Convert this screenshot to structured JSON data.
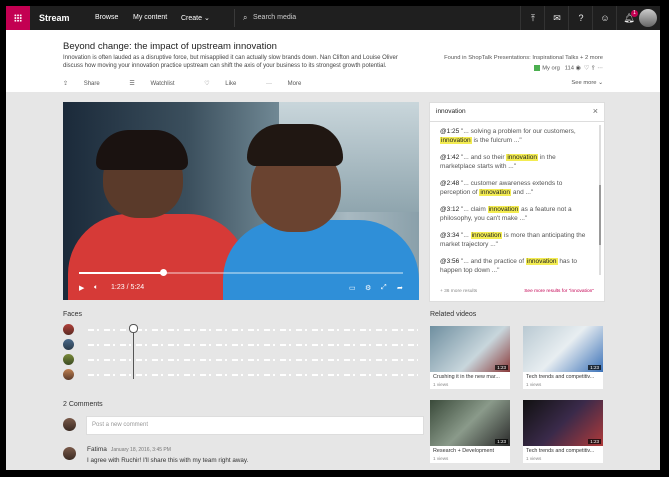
{
  "app": {
    "brand": "Stream"
  },
  "nav": {
    "items": [
      "Browse",
      "My content",
      "Create ⌄"
    ],
    "search_placeholder": "Search media"
  },
  "topbar": {
    "icons": [
      "upload-icon",
      "inbox-icon",
      "help-icon",
      "smiley-icon",
      "notifications-icon"
    ],
    "notification_count": "1"
  },
  "video": {
    "title": "Beyond change: the impact of upstream innovation",
    "description": "Innovation is often lauded as a disruptive force, but misapplied it can actually slow brands down. Nan Clifton and Louise Oliver discuss how moving your innovation practice upstream can shift the axis of your business to its strongest growth potential.",
    "actions": [
      "Share",
      "Watchlist",
      "Like",
      "More"
    ],
    "found_in": "Found in ShopTalk Presentations: Inspirational Talks + 2 more",
    "org": "My org",
    "views": "114",
    "see_more": "See more ⌄",
    "time": "1:23 / 5:24",
    "progress": 0.26
  },
  "transcript": {
    "query": "innovation",
    "items": [
      {
        "time": "@1:25",
        "pre": " \"... solving a problem for our customers, ",
        "hit": "innovation",
        "post": " is the fulcrum ...\""
      },
      {
        "time": "@1:42",
        "pre": " \"... and so their ",
        "hit": "innovation",
        "post": " in the marketplace starts with ...\""
      },
      {
        "time": "@2:48",
        "pre": " \"... customer awareness extends to perception of ",
        "hit": "innovation",
        "post": " and ...\""
      },
      {
        "time": "@3:12",
        "pre": " \"... claim ",
        "hit": "innovation",
        "post": " as a feature not a philosophy, you can't make ...\""
      },
      {
        "time": "@3:34",
        "pre": " \"... ",
        "hit": "innovation",
        "post": " is more than anticipating the market trajectory ...\""
      },
      {
        "time": "@3:56",
        "pre": " \"... and the practice of ",
        "hit": "innovation",
        "post": " has to happen top down ...\""
      }
    ],
    "more_results": "+ 36 more results",
    "see_more_results": "See more results for \"innovation\""
  },
  "faces": {
    "heading": "Faces",
    "count": 4
  },
  "comments": {
    "heading": "2 Comments",
    "placeholder": "Post a new comment",
    "list": [
      {
        "name": "Fatima",
        "date": "January 18, 2016, 3:45 PM",
        "text": "I agree with Ruchir! I'll share this with my team right away."
      }
    ]
  },
  "related": {
    "heading": "Related videos",
    "items": [
      {
        "title": "Crushing it in the new mar...",
        "views": "1 views",
        "duration": "1:23"
      },
      {
        "title": "Tech trends and competitiv...",
        "views": "1 views",
        "duration": "1:23"
      },
      {
        "title": "Research + Development",
        "views": "1 views",
        "duration": "1:23"
      },
      {
        "title": "Tech trends and competitiv...",
        "views": "1 views",
        "duration": "1:23"
      }
    ]
  },
  "colors": {
    "accent": "#c30052",
    "highlight": "#f3ec52",
    "nav_bg": "#1f1f1f"
  }
}
